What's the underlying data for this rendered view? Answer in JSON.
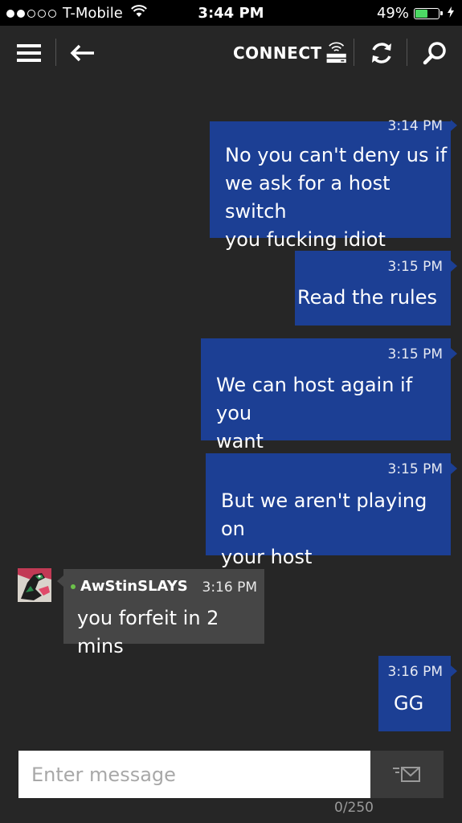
{
  "status_bar": {
    "carrier": "T-Mobile",
    "time": "3:44 PM",
    "battery_percent_label": "49%",
    "battery_level": 0.49,
    "signal_bars_filled": 2,
    "signal_bars_total": 5
  },
  "header": {
    "connect_label": "CONNECT",
    "icons": [
      "menu-icon",
      "back-arrow-icon",
      "console-icon",
      "refresh-icon",
      "search-icon"
    ]
  },
  "conversation": {
    "messages": [
      {
        "direction": "outgoing",
        "time": "3:14 PM",
        "lines": [
          "No you can't deny us if",
          "we ask for a host switch",
          "you fucking idiot"
        ]
      },
      {
        "direction": "outgoing",
        "time": "3:15 PM",
        "lines": [
          "Read the rules"
        ]
      },
      {
        "direction": "outgoing",
        "time": "3:15 PM",
        "lines": [
          "We can host again if you",
          "want"
        ]
      },
      {
        "direction": "outgoing",
        "time": "3:15 PM",
        "lines": [
          "But we aren't playing on",
          "your host"
        ]
      },
      {
        "direction": "incoming",
        "sender": "AwStinSLAYS",
        "online": true,
        "time": "3:16 PM",
        "lines": [
          "you forfeit in 2 mins"
        ]
      },
      {
        "direction": "outgoing",
        "time": "3:16 PM",
        "lines": [
          "GG"
        ]
      }
    ]
  },
  "composer": {
    "placeholder": "Enter message",
    "value": "",
    "counter": "0/250"
  },
  "colors": {
    "background": "#262626",
    "outgoing_bubble": "#1c3f94",
    "incoming_bubble": "#464646",
    "online_dot": "#6cc24a",
    "battery_fill": "#4cd964"
  }
}
